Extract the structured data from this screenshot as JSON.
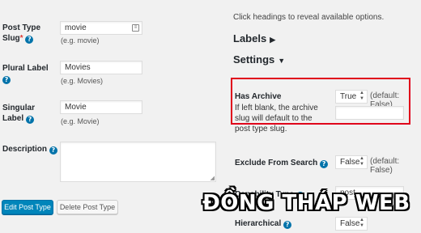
{
  "left": {
    "slug": {
      "label": "Post Type Slug",
      "required_mark": "*",
      "value": "movie",
      "hint": "(e.g. movie)"
    },
    "plural": {
      "label": "Plural Label",
      "value": "Movies",
      "hint": "(e.g. Movies)"
    },
    "singular": {
      "label": "Singular Label",
      "value": "Movie",
      "hint": "(e.g. Movie)"
    },
    "description": {
      "label": "Description",
      "value": ""
    },
    "buttons": {
      "edit": "Edit Post Type",
      "delete": "Delete Post Type"
    }
  },
  "right": {
    "intro": "Click headings to reveal available options.",
    "labels_heading": "Labels",
    "settings_heading": "Settings",
    "has_archive": {
      "label": "Has Archive",
      "note": "If left blank, the archive slug will default to the post type slug.",
      "value": "True",
      "default_text": "(default: False)",
      "slug_value": ""
    },
    "exclude_search": {
      "label": "Exclude From Search",
      "value": "False",
      "default_text": "(default: False)"
    },
    "capability": {
      "label": "Capability Type",
      "value": "post"
    },
    "hierarchical": {
      "label": "Hierarchical",
      "value": "False"
    }
  },
  "watermark": "ĐỒNG THÁP WEB",
  "icons": {
    "help": "help-icon",
    "collapsed": "triangle-right-icon",
    "expanded": "triangle-down-icon"
  },
  "colors": {
    "accent": "#0073aa",
    "highlight_box": "#e0001b"
  }
}
